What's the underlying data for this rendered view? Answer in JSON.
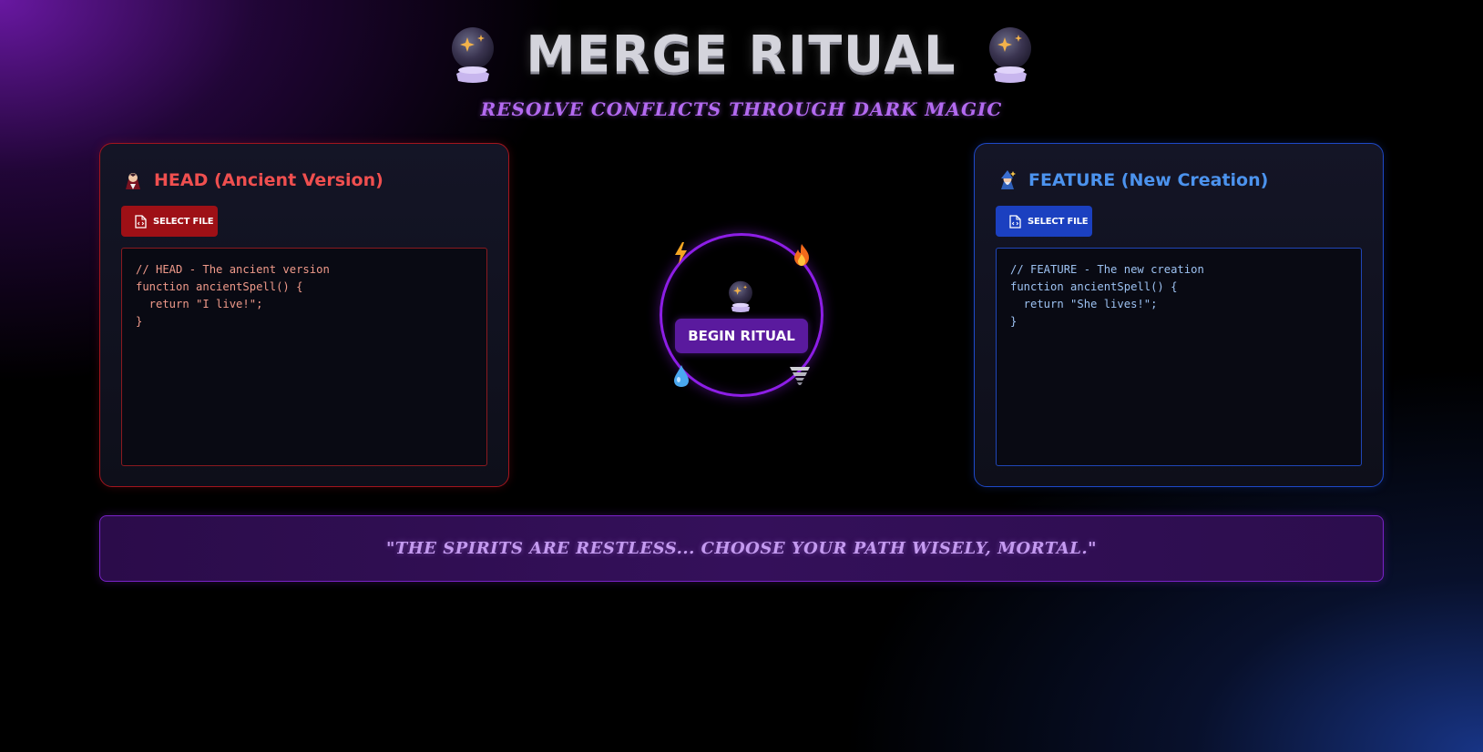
{
  "header": {
    "title": "MERGE RITUAL",
    "subtitle": "RESOLVE CONFLICTS THROUGH DARK MAGIC",
    "left_icon": "crystal-ball-icon",
    "right_icon": "crystal-ball-icon"
  },
  "head_panel": {
    "icon": "vampire-icon",
    "title": "HEAD (Ancient Version)",
    "select_label": "SELECT FILE",
    "code": "// HEAD - The ancient version\nfunction ancientSpell() {\n  return \"I live!\";\n}",
    "accent": "#ef4f4f",
    "button_color": "#9e1016"
  },
  "feature_panel": {
    "icon": "mage-icon",
    "title": "FEATURE (New Creation)",
    "select_label": "SELECT FILE",
    "code": "// FEATURE - The new creation\nfunction ancientSpell() {\n  return \"She lives!\";\n}",
    "accent": "#4c93ee",
    "button_color": "#1b40c0"
  },
  "ritual": {
    "button_label": "BEGIN RITUAL",
    "center_icon": "crystal-ball-icon",
    "elements": [
      "lightning-icon",
      "fire-icon",
      "water-drop-icon",
      "tornado-icon"
    ],
    "ring_color": "#8d1ee6"
  },
  "message": "\"THE SPIRITS ARE RESTLESS... CHOOSE YOUR PATH WISELY, MORTAL.\""
}
